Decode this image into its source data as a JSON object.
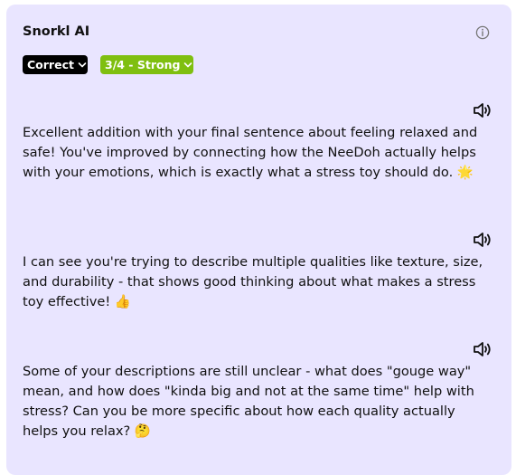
{
  "panel": {
    "title": "Snorkl AI",
    "info_icon": "info-circle-icon"
  },
  "badges": {
    "correctness": {
      "label": "Correct",
      "color": "#000000"
    },
    "strength": {
      "label": "3/4 - Strong",
      "color": "#7fbf10"
    }
  },
  "feedback": [
    {
      "text": "Excellent addition with your final sentence about feeling relaxed and safe! You've improved by connecting how the NeeDoh actually helps with your emotions, which is exactly what a stress toy should do. 🌟",
      "icon": "speaker-icon"
    },
    {
      "text": "I can see you're trying to describe multiple qualities like texture, size, and durability - that shows good thinking about what makes a stress toy effective! 👍",
      "icon": "speaker-icon"
    },
    {
      "text": "Some of your descriptions are still unclear - what does \"gouge way\" mean, and how does \"kinda big and not at the same time\" help with stress? Can you be more specific about how each quality actually helps you relax? 🤔",
      "icon": "speaker-icon"
    }
  ],
  "colors": {
    "panel_background": "#e9e5ff",
    "text": "#111111"
  }
}
